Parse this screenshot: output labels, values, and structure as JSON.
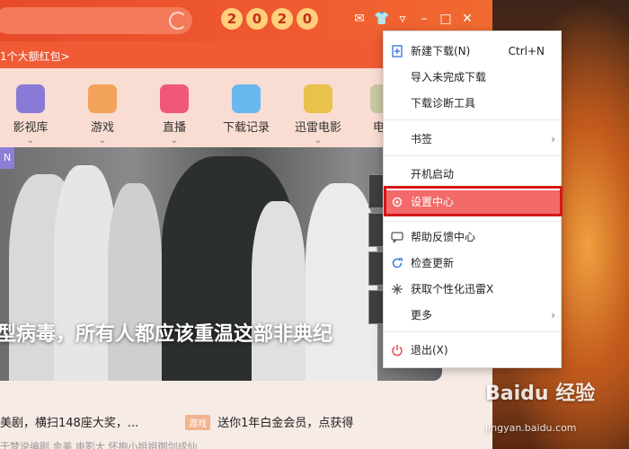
{
  "promo_bar": {
    "text": "1个大额红包>"
  },
  "title_banner": {
    "digits": [
      "2",
      "0",
      "2",
      "0"
    ]
  },
  "window_controls": [
    "mail-icon",
    "skin-icon",
    "menu-icon",
    "minimize-icon",
    "maximize-icon",
    "close-icon"
  ],
  "nav": {
    "items": [
      {
        "label": "影视库",
        "color": "#8a7ad8"
      },
      {
        "label": "游戏",
        "color": "#f3a25a"
      },
      {
        "label": "直播",
        "color": "#f0587a"
      },
      {
        "label": "下载记录",
        "color": "#6ab8f0"
      },
      {
        "label": "迅雷电影",
        "color": "#e8c24a"
      },
      {
        "label": "电影",
        "color": "#c8c8a0"
      }
    ]
  },
  "hero": {
    "tag": "N",
    "caption": "型病毒，所有人都应该重温这部非典纪"
  },
  "news": {
    "left": "美剧，横扫148座大奖，...",
    "right_badge": "游戏",
    "right": "送你1年白金会员，点获得"
  },
  "subline": "于梦说编剧   金美   电影大   怀抱小姐姐御剑成仙",
  "menu": {
    "items": [
      {
        "label": "新建下载(N)",
        "shortcut": "Ctrl+N",
        "icon": "new-download-icon"
      },
      {
        "label": "导入未完成下载"
      },
      {
        "label": "下载诊断工具"
      },
      {
        "label": "书签",
        "submenu": true
      },
      {
        "label": "开机启动"
      },
      {
        "label": "设置中心",
        "icon": "gear-icon",
        "active": true
      },
      {
        "label": "帮助反馈中心",
        "icon": "chat-icon"
      },
      {
        "label": "检查更新",
        "icon": "refresh-icon"
      },
      {
        "label": "获取个性化迅雷X",
        "icon": "sparkle-icon"
      },
      {
        "label": "更多",
        "submenu": true
      },
      {
        "label": "退出(X)",
        "icon": "power-icon"
      }
    ]
  },
  "watermark": {
    "brand": "Baidu 经验",
    "url": "jingyan.baidu.com"
  }
}
